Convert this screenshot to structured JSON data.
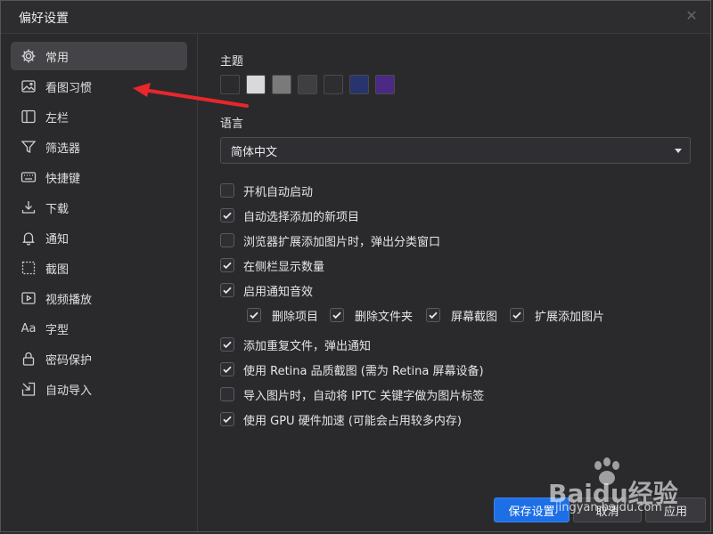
{
  "window": {
    "title": "偏好设置"
  },
  "sidebar": {
    "items": [
      {
        "label": "常用",
        "icon": "gear-icon",
        "active": true
      },
      {
        "label": "看图习惯",
        "icon": "image-icon"
      },
      {
        "label": "左栏",
        "icon": "sidebar-panel-icon"
      },
      {
        "label": "筛选器",
        "icon": "filter-icon"
      },
      {
        "label": "快捷键",
        "icon": "keyboard-icon"
      },
      {
        "label": "下载",
        "icon": "download-icon"
      },
      {
        "label": "通知",
        "icon": "bell-icon"
      },
      {
        "label": "截图",
        "icon": "screenshot-icon"
      },
      {
        "label": "视频播放",
        "icon": "video-play-icon"
      },
      {
        "label": "字型",
        "icon": "font-icon"
      },
      {
        "label": "密码保护",
        "icon": "lock-icon"
      },
      {
        "label": "自动导入",
        "icon": "auto-import-icon"
      }
    ]
  },
  "main": {
    "theme_label": "主题",
    "theme_colors": [
      "#2b2b2e",
      "#d9d9d9",
      "#7a7a7a",
      "#3f3f42",
      "#2e2e31",
      "#27346e",
      "#4a2a82"
    ],
    "language_label": "语言",
    "language_value": "简体中文",
    "options": [
      {
        "label": "开机自动启动",
        "checked": false
      },
      {
        "label": "自动选择添加的新项目",
        "checked": true
      },
      {
        "label": "浏览器扩展添加图片时，弹出分类窗口",
        "checked": false
      },
      {
        "label": "在侧栏显示数量",
        "checked": true
      },
      {
        "label": "启用通知音效",
        "checked": true
      },
      {
        "label": "添加重复文件，弹出通知",
        "checked": true
      },
      {
        "label": "使用 Retina 品质截图 (需为 Retina 屏幕设备)",
        "checked": true
      },
      {
        "label": "导入图片时，自动将 IPTC 关键字做为图片标签",
        "checked": false
      },
      {
        "label": "使用 GPU 硬件加速 (可能会占用较多内存)",
        "checked": true
      }
    ],
    "sound_options": [
      {
        "label": "删除项目",
        "checked": true
      },
      {
        "label": "删除文件夹",
        "checked": true
      },
      {
        "label": "屏幕截图",
        "checked": true
      },
      {
        "label": "扩展添加图片",
        "checked": true
      }
    ]
  },
  "footer": {
    "save_label": "保存设置",
    "cancel_label": "取消",
    "apply_label": "应用"
  },
  "watermark": {
    "brand": "Baidu经验",
    "url": "jingyan.baidu.com"
  },
  "colors": {
    "accent": "#1e6fe6",
    "annotation_arrow": "#e8272b"
  }
}
